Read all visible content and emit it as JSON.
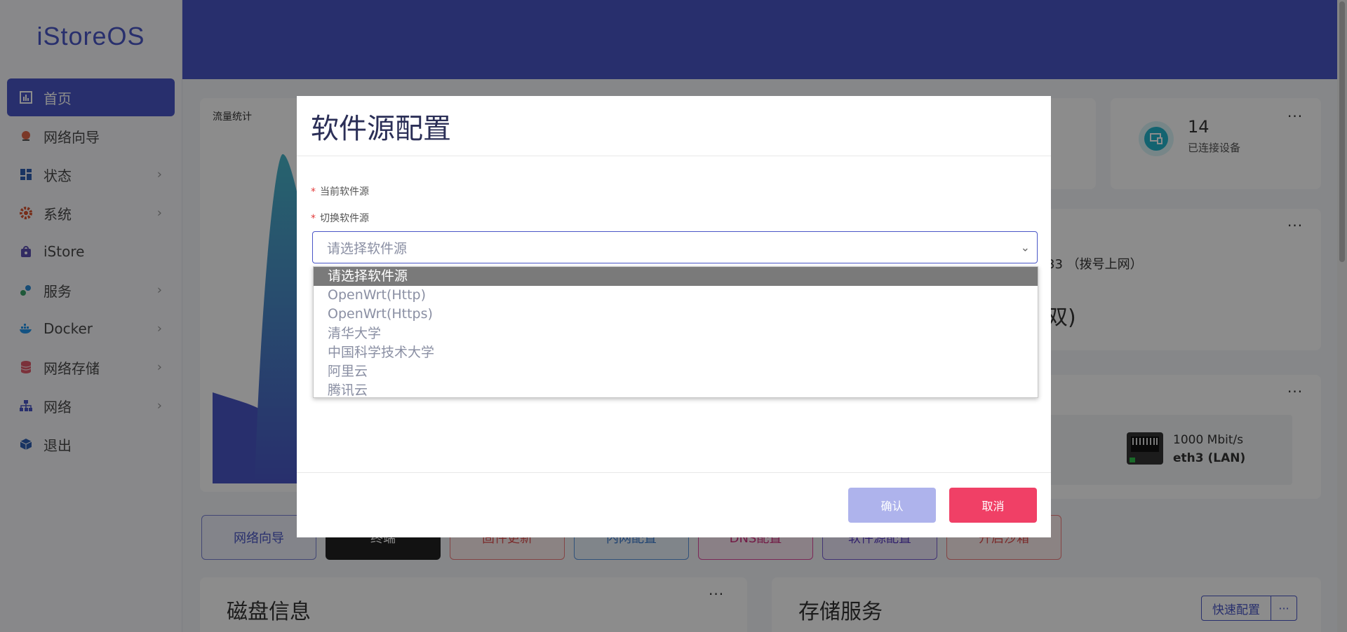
{
  "brand": "iStoreOS",
  "sidebar": {
    "items": [
      {
        "label": "首页",
        "icon": "chart-icon",
        "active": true,
        "has_children": false
      },
      {
        "label": "网络向导",
        "icon": "globe-icon",
        "active": false,
        "has_children": false
      },
      {
        "label": "状态",
        "icon": "dashboard-icon",
        "active": false,
        "has_children": true
      },
      {
        "label": "系统",
        "icon": "gear-icon",
        "active": false,
        "has_children": true
      },
      {
        "label": "iStore",
        "icon": "store-bag-icon",
        "active": false,
        "has_children": false
      },
      {
        "label": "服务",
        "icon": "cogs-icon",
        "active": false,
        "has_children": true
      },
      {
        "label": "Docker",
        "icon": "docker-icon",
        "active": false,
        "has_children": true
      },
      {
        "label": "网络存储",
        "icon": "database-icon",
        "active": false,
        "has_children": true
      },
      {
        "label": "网络",
        "icon": "network-icon",
        "active": false,
        "has_children": true
      },
      {
        "label": "退出",
        "icon": "logout-cube-icon",
        "active": false,
        "has_children": false
      }
    ]
  },
  "dashboard": {
    "traffic_title": "流量统计",
    "devices_count": "14",
    "devices_label": "已连接设备",
    "network_text": "33 （拨号上网）",
    "network_big_fragment": "双)",
    "port_speed": "1000 Mbit/s",
    "port_name": "eth3 (LAN)",
    "quick_buttons": [
      "网络向导",
      "终端",
      "固件更新",
      "内网配置",
      "DNS配置",
      "软件源配置",
      "开启沙箱"
    ],
    "disk_title": "磁盘信息",
    "storage_title": "存储服务",
    "quick_config_label": "快速配置"
  },
  "modal": {
    "title": "软件源配置",
    "current_label": "当前软件源",
    "switch_label": "切换软件源",
    "select_placeholder": "请选择软件源",
    "options": [
      "请选择软件源",
      "OpenWrt(Http)",
      "OpenWrt(Https)",
      "清华大学",
      "中国科学技术大学",
      "阿里云",
      "腾讯云"
    ],
    "selected_index": 0,
    "ok_label": "确认",
    "cancel_label": "取消"
  },
  "colors": {
    "primary": "#4a56c7",
    "danger": "#f04066",
    "disabled_primary": "#aeb3ec"
  }
}
